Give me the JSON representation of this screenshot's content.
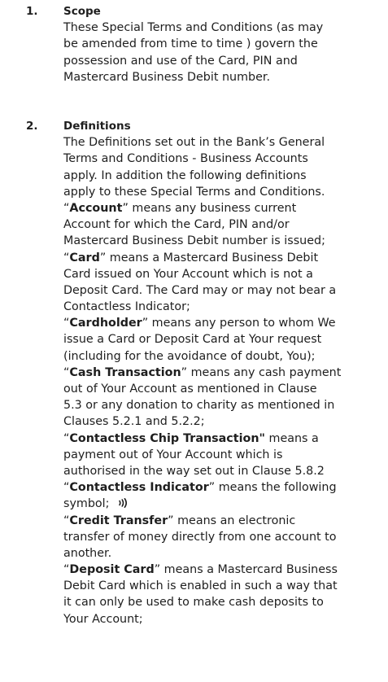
{
  "sections": [
    {
      "number": "1.",
      "title": "Scope",
      "lines": [
        "These Special Terms and Conditions (as may",
        "be amended from time to time ) govern the",
        "possession and use of the Card, PIN and",
        "Mastercard Business Debit number."
      ]
    },
    {
      "number": "2.",
      "title": "Definitions",
      "intro_lines": [
        "The Definitions set out in the Bank’s General",
        "Terms and Conditions - Business Accounts",
        "apply. In addition the following definitions",
        "apply to these Special Terms and Conditions."
      ],
      "definitions": [
        {
          "term": "Account",
          "lines": [
            "” means any business current",
            "Account for which the Card, PIN and/or",
            "Mastercard Business Debit number is issued;"
          ]
        },
        {
          "term": "Card",
          "lines": [
            "” means a Mastercard Business Debit",
            "Card issued on Your Account which is not a",
            "Deposit Card. The Card may or may not bear a",
            "Contactless Indicator;"
          ]
        },
        {
          "term": "Cardholder",
          "lines": [
            "” means any person to whom We",
            "issue a Card or Deposit Card at Your request",
            "(including for the avoidance of doubt, You);"
          ]
        },
        {
          "term": "Cash Transaction",
          "lines": [
            "” means any cash payment",
            "out of Your Account as mentioned in Clause",
            "5.3 or any donation to charity as mentioned in",
            "Clauses 5.2.1 and 5.2.2;"
          ]
        },
        {
          "term": "Contactless Chip Transaction\"",
          "lines": [
            " means a",
            "payment out of Your Account which is",
            "authorised in the way set out in Clause 5.8.2"
          ]
        },
        {
          "term": "Contactless Indicator",
          "lines": [
            "” means the following",
            "symbol;"
          ]
        },
        {
          "term": "Credit Transfer",
          "lines": [
            "” means an electronic",
            "transfer of money directly from one account to",
            "another."
          ]
        },
        {
          "term": "Deposit Card",
          "lines": [
            "” means a Mastercard Business",
            "Debit Card which is enabled in such a way that",
            "it can only be used to make cash deposits to",
            "Your Account;"
          ]
        }
      ]
    }
  ],
  "open_quote": "“",
  "icons": {
    "contactless": "contactless-indicator-icon"
  }
}
